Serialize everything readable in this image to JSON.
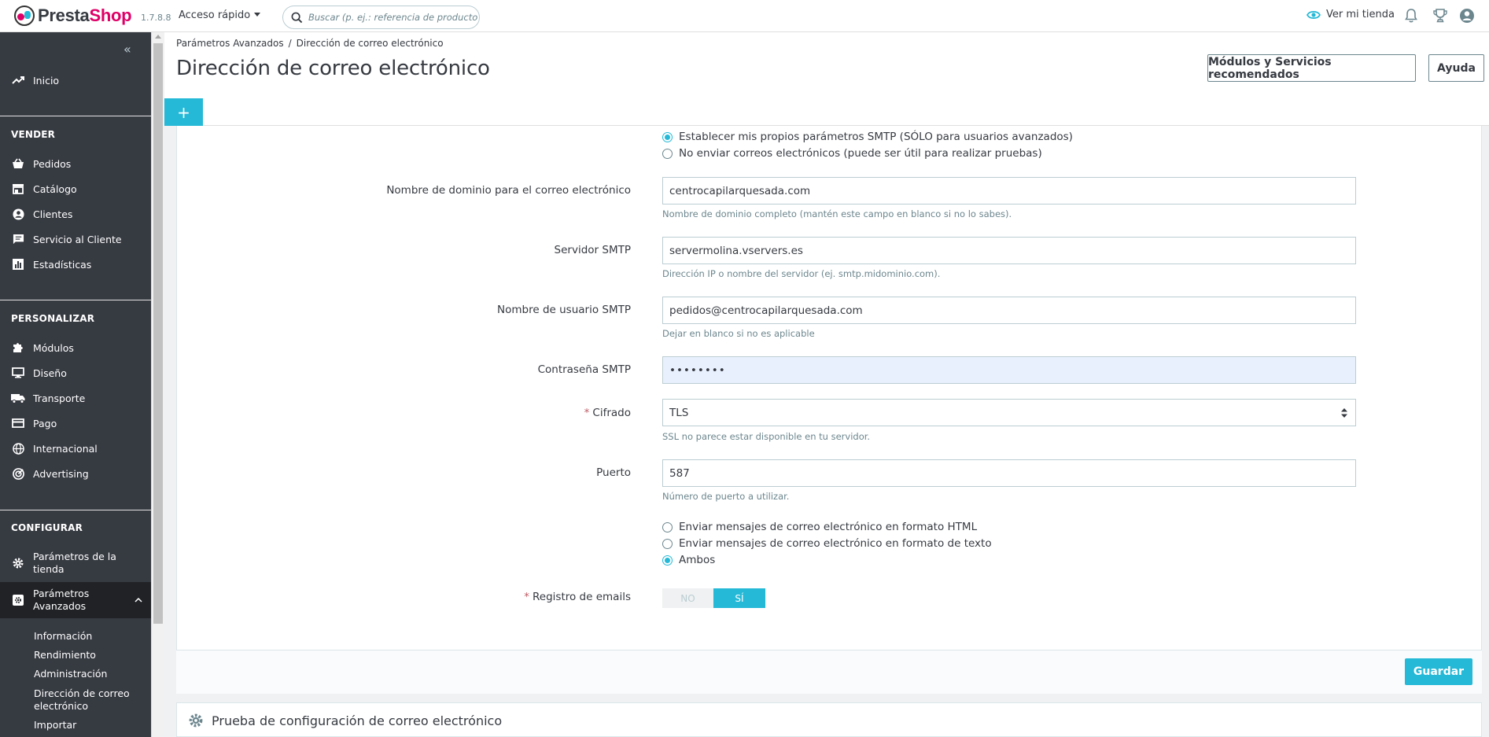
{
  "header": {
    "logo_part1": "Presta",
    "logo_part2": "Shop",
    "version": "1.7.8.8",
    "quick_access": "Acceso rápido",
    "search_placeholder": "Buscar (p. ej.: referencia de producto, nombre de cliente...)",
    "view_shop": "Ver mi tienda"
  },
  "sidebar": {
    "home": "Inicio",
    "sections": {
      "sell": "VENDER",
      "customize": "PERSONALIZAR",
      "configure": "CONFIGURAR"
    },
    "sell_items": [
      "Pedidos",
      "Catálogo",
      "Clientes",
      "Servicio al Cliente",
      "Estadísticas"
    ],
    "customize_items": [
      "Módulos",
      "Diseño",
      "Transporte",
      "Pago",
      "Internacional",
      "Advertising"
    ],
    "configure_items": {
      "shop_params_line1": "Parámetros de la",
      "shop_params_line2": "tienda",
      "adv_params_line1": "Parámetros",
      "adv_params_line2": "Avanzados"
    },
    "sub_items": [
      "Información",
      "Rendimiento",
      "Administración",
      "Dirección de correo",
      "electrónico",
      "Importar"
    ]
  },
  "page": {
    "breadcrumb_parent": "Parámetros Avanzados",
    "breadcrumb_sep": "/",
    "breadcrumb_current": "Dirección de correo electrónico",
    "title": "Dirección de correo electrónico",
    "recommended_button": "Módulos y Servicios recomendados",
    "help_button": "Ayuda",
    "add_tab": "+"
  },
  "form": {
    "smtp_option_own": "Establecer mis propios parámetros SMTP (SÓLO para usuarios avanzados)",
    "smtp_option_none": "No enviar correos electrónicos (puede ser útil para realizar pruebas)",
    "domain_label": "Nombre de dominio para el correo electrónico",
    "domain_value": "centrocapilarquesada.com",
    "domain_help": "Nombre de dominio completo (mantén este campo en blanco si no lo sabes).",
    "server_label": "Servidor SMTP",
    "server_value": "servermolina.vservers.es",
    "server_help": "Dirección IP o nombre del servidor (ej. smtp.midominio.com).",
    "user_label": "Nombre de usuario SMTP",
    "user_value": "pedidos@centrocapilarquesada.com",
    "user_help": "Dejar en blanco si no es aplicable",
    "password_label": "Contraseña SMTP",
    "password_value": "••••••••",
    "encryption_required": "*",
    "encryption_label": "Cifrado",
    "encryption_value": "TLS",
    "encryption_help": "SSL no parece estar disponible en tu servidor.",
    "port_label": "Puerto",
    "port_value": "587",
    "port_help": "Número de puerto a utilizar.",
    "format_html": "Enviar mensajes de correo electrónico en formato HTML",
    "format_text": "Enviar mensajes de correo electrónico en formato de texto",
    "format_both": "Ambos",
    "log_required": "*",
    "log_label": "Registro de emails",
    "log_no": "NO",
    "log_yes": "SÍ",
    "save_button": "Guardar"
  },
  "test_panel": {
    "title": "Prueba de configuración de correo electrónico"
  },
  "colors": {
    "accent": "#25b9d7",
    "sidebar_bg": "#363a41",
    "brand_pink": "#df0067"
  }
}
